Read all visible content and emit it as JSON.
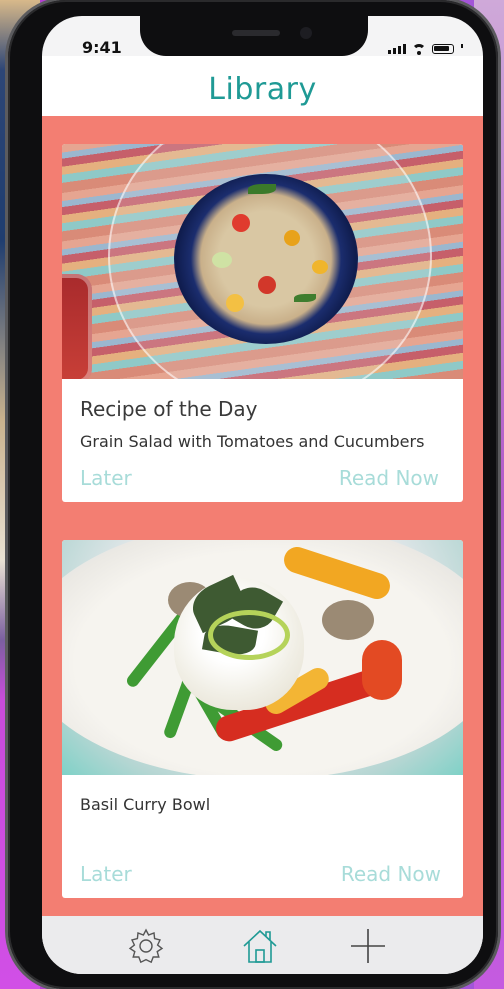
{
  "status": {
    "time": "9:41"
  },
  "header": {
    "title": "Library"
  },
  "cards": [
    {
      "heading": "Recipe of the Day",
      "subtitle": "Grain Salad with Tomatoes and Cucumbers",
      "later_label": "Later",
      "read_label": "Read Now",
      "image": "grain-salad-photo"
    },
    {
      "subtitle": "Basil Curry Bowl",
      "later_label": "Later",
      "read_label": "Read Now",
      "image": "basil-curry-bowl-photo"
    }
  ],
  "tabbar": {
    "items": [
      {
        "icon": "gear-icon"
      },
      {
        "icon": "home-icon"
      },
      {
        "icon": "plus-icon"
      }
    ]
  },
  "colors": {
    "accent_teal": "#1f9a95",
    "action_light_teal": "#a8dcd9",
    "content_bg_coral": "#f37e72"
  }
}
